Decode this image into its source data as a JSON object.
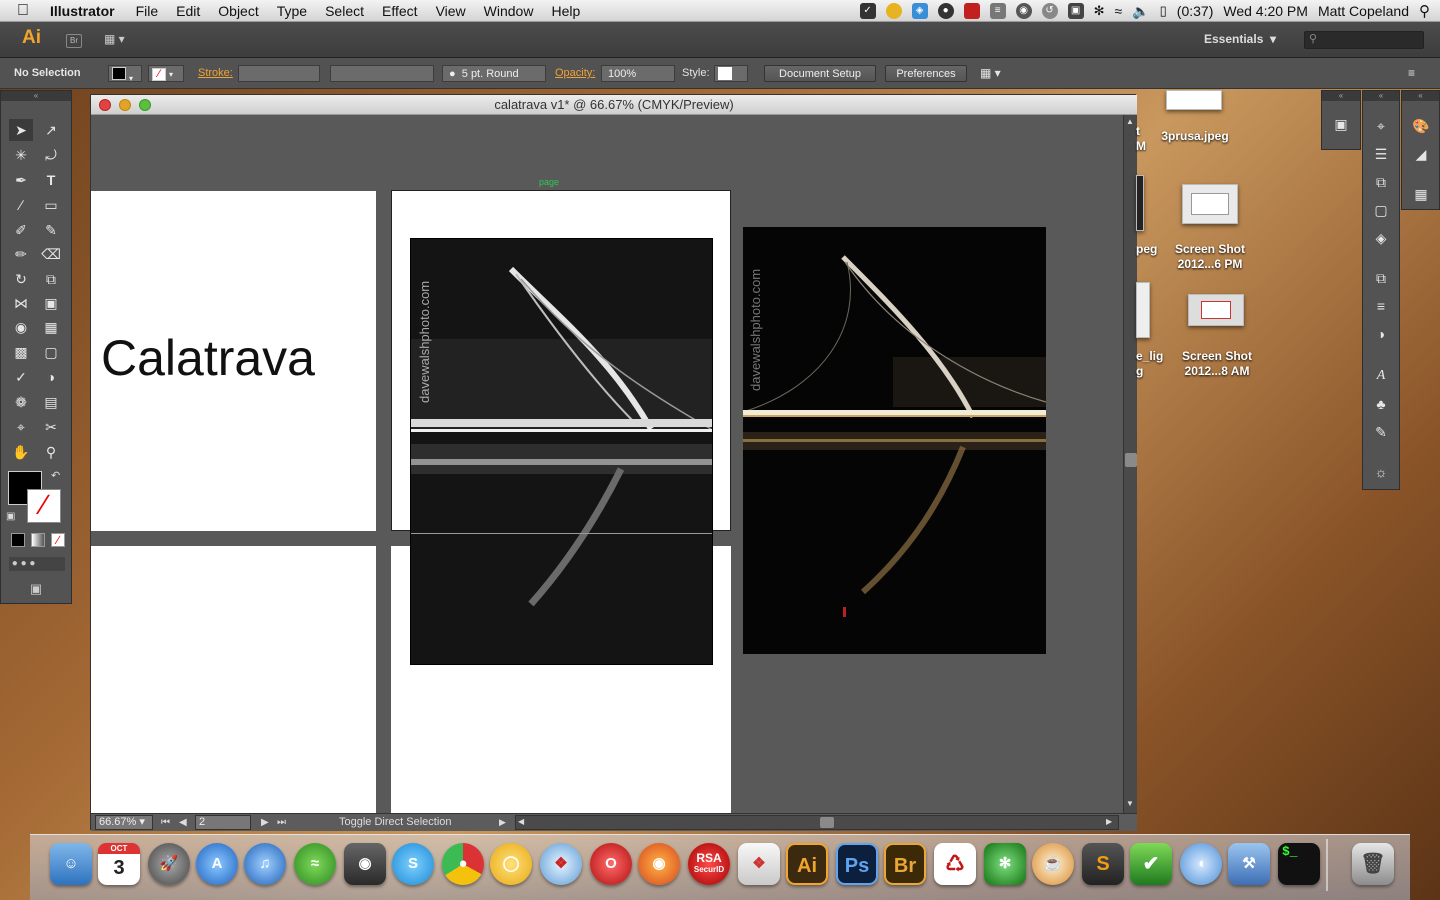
{
  "menubar": {
    "app": "Illustrator",
    "items": [
      "File",
      "Edit",
      "Object",
      "Type",
      "Select",
      "Effect",
      "View",
      "Window",
      "Help"
    ],
    "battery": "(0:37)",
    "clock": "Wed 4:20 PM",
    "user": "Matt Copeland"
  },
  "appbar": {
    "logo": "Ai",
    "bridge": "Br",
    "workspace": "Essentials"
  },
  "control": {
    "selection": "No Selection",
    "stroke_label": "Stroke:",
    "brush": "5 pt. Round",
    "opacity_label": "Opacity:",
    "opacity_value": "100%",
    "style_label": "Style:",
    "document_setup": "Document Setup",
    "preferences": "Preferences"
  },
  "document": {
    "title": "calatrava v1* @ 66.67% (CMYK/Preview)",
    "heading": "Calatrava",
    "page_label": "page",
    "watermark": "davewalshphoto.com",
    "zoom": "66.67%",
    "artboard_number": "2",
    "status": "Toggle Direct Selection"
  },
  "desktop": {
    "icons": [
      {
        "label": "3prusa.jpeg"
      },
      {
        "label": "Screen Shot 2012...6 PM"
      },
      {
        "label": "Screen Shot 2012...8 AM"
      }
    ],
    "partial_labels": [
      "t",
      "M",
      "peg",
      "e_lig",
      "g"
    ]
  },
  "dock": {
    "calendar_month": "OCT",
    "calendar_day": "3",
    "rsa_label": "RSA",
    "rsa_sub": "SecurID",
    "ai": "Ai",
    "ps": "Ps",
    "br": "Br",
    "sublime": "S",
    "terminal": "$_"
  },
  "colors": {
    "ai_orange": "#f1a52c",
    "ps_blue": "#2d6ab0",
    "accent_label": "#f0a236"
  }
}
